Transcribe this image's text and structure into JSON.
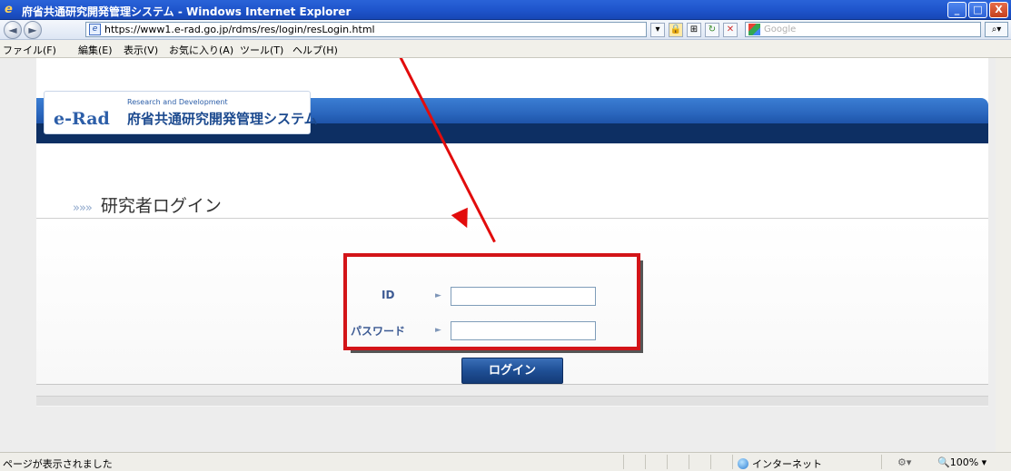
{
  "window": {
    "title": "府省共通研究開発管理システム - Windows Internet Explorer",
    "buttons": {
      "minimize": "_",
      "maximize": "□",
      "close": "X"
    }
  },
  "addressbar": {
    "url": "https://www1.e-rad.go.jp/rdms/res/login/resLogin.html",
    "search_placeholder": "Google"
  },
  "menu": [
    "ファイル(F)",
    "編集(E)",
    "表示(V)",
    "お気に入り(A)",
    "ツール(T)",
    "ヘルプ(H)"
  ],
  "header": {
    "logo_mark": "e-Rad",
    "logo_subtitle": "Research and Development",
    "logo_title": "府省共通研究開発管理システム"
  },
  "page": {
    "chevrons": "»»»",
    "heading": "研究者ログイン"
  },
  "form": {
    "id_label": "ID",
    "id_value": "",
    "password_label": "パスワード",
    "password_value": "",
    "field_arrow": "►",
    "login_button": "ログイン"
  },
  "statusbar": {
    "message": "ページが表示されました",
    "zone": "インターネット",
    "zoom": "100%"
  },
  "colors": {
    "header_blue": "#2a66bd",
    "highlight_red": "#d31418",
    "button_blue": "#1f4f95"
  }
}
